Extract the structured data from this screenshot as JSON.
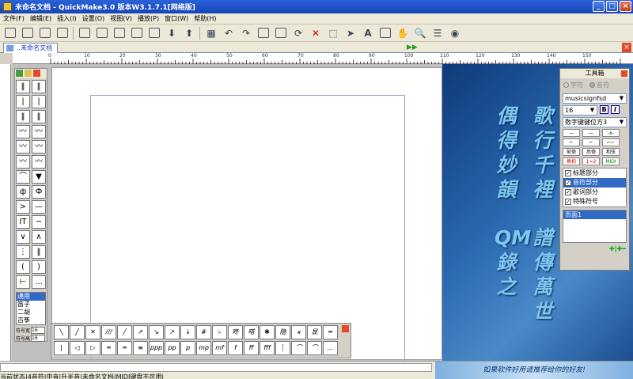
{
  "window": {
    "title": "未命名文档 - QuickMake3.0 版本W3.1.7.1[网络版]",
    "controls": [
      "_",
      "□",
      "×"
    ]
  },
  "menubar": {
    "items": [
      "文件(F)",
      "编辑(E)",
      "插入(I)",
      "设置(O)",
      "视图(V)",
      "播放(P)",
      "窗口(W)",
      "帮助(H)"
    ]
  },
  "toolbar": {
    "text_tool_label": "A"
  },
  "tab": {
    "label": "..未命名文档",
    "arrows": "▶▶"
  },
  "rulers": {
    "h_labels": [
      "0",
      "10",
      "20",
      "30",
      "40",
      "50",
      "60",
      "70",
      "80",
      "90",
      "100",
      "110",
      "120",
      "130",
      "140",
      "150"
    ]
  },
  "left_palette": {
    "symbols": [
      "‖",
      "‖",
      "|",
      "|",
      "‖",
      "‖",
      "〰",
      "〰",
      "〰",
      "〰",
      "〰",
      "〰",
      "⌒",
      "▼",
      "ф",
      "Ф",
      ">",
      "—",
      "IT",
      "~",
      "∨",
      "∧",
      "⋮",
      "‖",
      "(",
      ")",
      "⊢",
      "…"
    ],
    "instruments": [
      "通用",
      "笛子",
      "二胡",
      "古筝"
    ],
    "field1_label": "符号宽",
    "field1_value": "16",
    "field2_label": "符号高",
    "field2_value": "16"
  },
  "bottom_palette": {
    "row1": [
      "╲",
      "╱",
      "✕",
      "///",
      "╱",
      "↗",
      "↘",
      "↗",
      "↓",
      "#",
      "♭",
      "咚",
      "嗒",
      "✱",
      "隐",
      "⚹",
      "显",
      "═"
    ],
    "row2": [
      "|",
      "◁",
      "▷",
      "═",
      "═",
      "≡",
      "ppp",
      "pp",
      "p",
      "mp",
      "mf",
      "f",
      "ff",
      "fff",
      "┆",
      "⌒",
      "⌒",
      "…"
    ]
  },
  "banner": {
    "col1": "歌行千裡",
    "col2": "偶得妙韻",
    "col3": "譜傳萬世",
    "col4": "QM錄之"
  },
  "toolbox": {
    "title": "工具箱",
    "radio_a": "字符",
    "radio_b": "音符",
    "font": "musicsignfsd",
    "size": "16",
    "bold": "B",
    "italic": "I",
    "layout": "数字键键位方3",
    "mini_row3": [
      "前倚",
      "后倚",
      "和弦"
    ],
    "mini_row4": [
      "换拍",
      "1=2",
      "MIDI"
    ],
    "sections": [
      "标题部分",
      "音符部分",
      "歌词部分",
      "特殊符号"
    ],
    "page_item": "页面1",
    "footer_icons": "✚|✚━"
  },
  "status": {
    "text": "当前状态|4音符|中音|升半音|未命名文档|MIDI键盘不可用|",
    "ad": "如果软件好用请推荐给你的好友!"
  }
}
